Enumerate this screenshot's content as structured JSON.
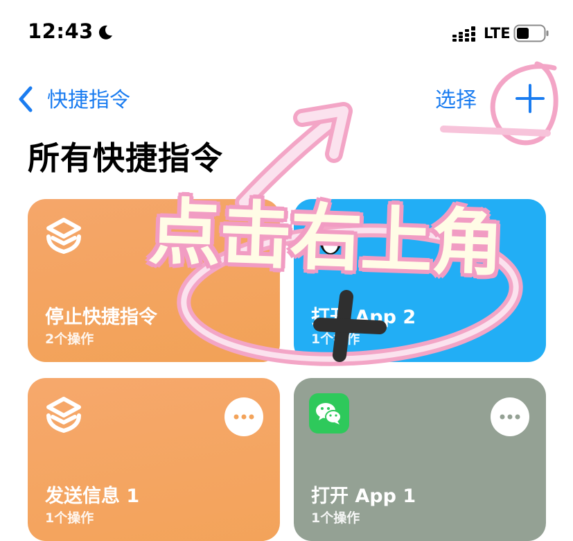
{
  "status_bar": {
    "time": "12:43",
    "network": "LTE"
  },
  "nav": {
    "back_label": "快捷指令",
    "select_label": "选择",
    "add_label": "+"
  },
  "page_title": "所有快捷指令",
  "cards": [
    {
      "title": "停止快捷指令",
      "subtitle": "2个操作",
      "icon": "shortcuts-layers-icon",
      "color": "#f3a35c"
    },
    {
      "title": "打开 App 2",
      "subtitle": "1个操作",
      "icon": "qq-icon",
      "color": "#22aef5"
    },
    {
      "title": "发送信息 1",
      "subtitle": "1个操作",
      "icon": "shortcuts-layers-icon",
      "color": "#f4a561"
    },
    {
      "title": "打开 App 1",
      "subtitle": "1个操作",
      "icon": "wechat-icon",
      "color": "#94a194"
    }
  ],
  "overlay": {
    "sticker_text": "点击右上角",
    "highlight_color": "#f5a9c9"
  }
}
